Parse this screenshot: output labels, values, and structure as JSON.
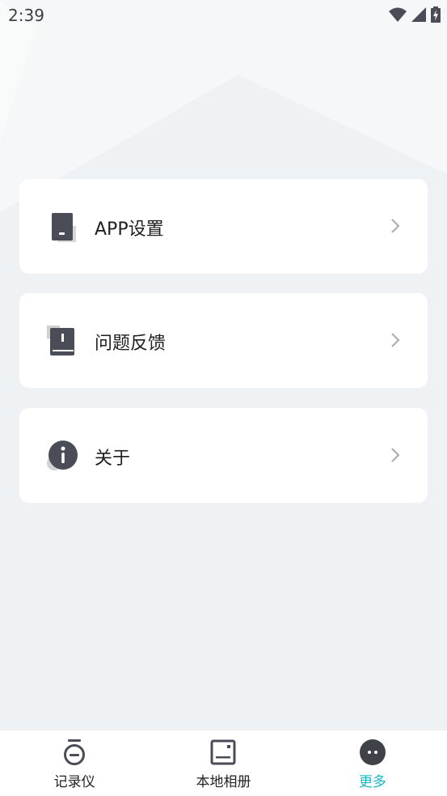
{
  "status_bar": {
    "time": "2:39",
    "icons": [
      "wifi-icon",
      "signal-icon",
      "battery-charging-icon"
    ]
  },
  "menu": [
    {
      "label": "APP设置",
      "icon": "settings-phone-icon"
    },
    {
      "label": "问题反馈",
      "icon": "feedback-book-icon"
    },
    {
      "label": "关于",
      "icon": "info-icon"
    }
  ],
  "tabs": [
    {
      "label": "记录仪",
      "icon": "recorder-icon",
      "active": false
    },
    {
      "label": "本地相册",
      "icon": "album-icon",
      "active": false
    },
    {
      "label": "更多",
      "icon": "more-icon",
      "active": true
    }
  ],
  "colors": {
    "accent": "#16b6c4",
    "background": "#eff2f5",
    "card": "#ffffff",
    "icon_dark": "#4a4d57"
  }
}
